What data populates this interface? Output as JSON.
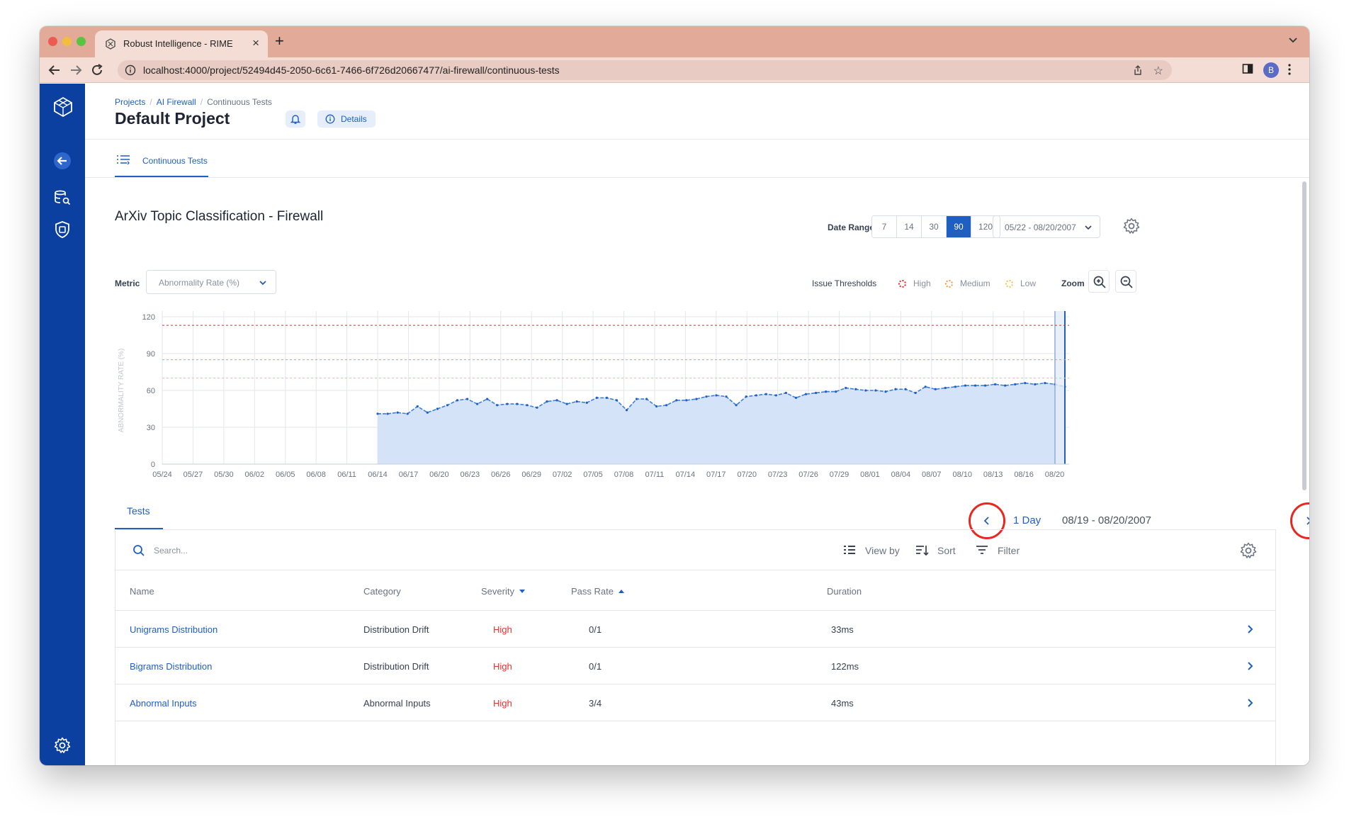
{
  "browser": {
    "tab_title": "Robust Intelligence - RIME",
    "url": "localhost:4000/project/52494d45-2050-6c61-7466-6f726d20667477/ai-firewall/continuous-tests",
    "profile_initial": "B"
  },
  "colors": {
    "sidebar": "#0b3fa0",
    "accent": "#1f5fc2",
    "severity_high": "#e0352b",
    "threshold_high": "#e8281e",
    "threshold_medium": "#f2994a",
    "threshold_low": "#f6c453",
    "area_fill": "#d4e3f8",
    "annotation": "#e8281e"
  },
  "sidebar": {
    "icons": [
      "logo-icon",
      "back-arrow-icon",
      "data-search-icon",
      "shield-chip-icon",
      "settings-gear-icon"
    ]
  },
  "breadcrumb": {
    "projects": "Projects",
    "firewall": "AI Firewall",
    "current": "Continuous Tests"
  },
  "header": {
    "title": "Default Project",
    "details_label": "Details"
  },
  "subnav": {
    "tab_label": "Continuous Tests"
  },
  "section": {
    "title": "ArXiv Topic Classification - Firewall"
  },
  "date_range": {
    "label": "Date Range",
    "options": [
      "7",
      "14",
      "30",
      "90",
      "120"
    ],
    "selected": "90",
    "value": "05/22 - 08/20/2007"
  },
  "metric": {
    "label": "Metric",
    "value": "Abnormality Rate (%)"
  },
  "thresholds": {
    "label": "Issue Thresholds",
    "high": "High",
    "medium": "Medium",
    "low": "Low"
  },
  "zoom": {
    "label": "Zoom"
  },
  "chart_data": {
    "type": "area",
    "ylabel": "ABNORMALITY RATE (%)",
    "ylim": [
      0,
      120
    ],
    "yticks": [
      "0",
      "30",
      "60",
      "90",
      "120"
    ],
    "x_tick_labels": [
      "05/24",
      "05/27",
      "05/30",
      "06/02",
      "06/05",
      "06/08",
      "06/11",
      "06/14",
      "06/17",
      "06/20",
      "06/23",
      "06/26",
      "06/29",
      "07/02",
      "07/05",
      "07/08",
      "07/11",
      "07/14",
      "07/17",
      "07/20",
      "07/23",
      "07/26",
      "07/29",
      "08/01",
      "08/04",
      "08/07",
      "08/10",
      "08/13",
      "08/16",
      "08/20"
    ],
    "x_dates": [
      "05/24",
      "05/27",
      "05/30",
      "06/02",
      "06/05",
      "06/08",
      "06/11",
      "06/14",
      "06/17",
      "06/20",
      "06/23",
      "06/26",
      "06/29",
      "07/02",
      "07/05",
      "07/08",
      "07/11",
      "07/14",
      "07/17",
      "07/20",
      "07/23",
      "07/26",
      "07/29",
      "08/01",
      "08/04",
      "08/07",
      "08/10",
      "08/13",
      "08/16",
      "08/19"
    ],
    "grid": true,
    "thresholds": {
      "high": 113,
      "medium": 85,
      "low": 70
    },
    "series": [
      {
        "x_start": "06/14",
        "x_end": "08/20",
        "values": [
          41,
          41,
          42,
          41,
          47,
          42,
          45,
          48,
          52,
          53,
          49,
          53,
          48,
          49,
          49,
          48,
          46,
          51,
          52,
          49,
          51,
          50,
          54,
          54,
          52,
          44,
          53,
          53,
          47,
          48,
          52,
          52,
          53,
          55,
          56,
          55,
          48,
          55,
          56,
          57,
          56,
          58,
          54,
          57,
          58,
          59,
          59,
          62,
          61,
          60,
          60,
          59,
          61,
          61,
          58,
          63,
          61,
          62,
          63,
          64,
          64,
          64,
          65,
          64,
          65,
          66,
          65,
          66,
          65,
          63
        ]
      }
    ],
    "selected_day": "08/20"
  },
  "tests": {
    "tab_label": "Tests",
    "day_label": "1 Day",
    "range_label": "08/19 - 08/20/2007",
    "search_placeholder": "Search...",
    "view_by_label": "View by",
    "sort_label": "Sort",
    "filter_label": "Filter",
    "columns": {
      "name": "Name",
      "category": "Category",
      "severity": "Severity",
      "pass_rate": "Pass Rate",
      "duration": "Duration"
    },
    "rows": [
      {
        "name": "Unigrams Distribution",
        "category": "Distribution Drift",
        "severity": "High",
        "pass_rate": "0/1",
        "duration": "33ms"
      },
      {
        "name": "Bigrams Distribution",
        "category": "Distribution Drift",
        "severity": "High",
        "pass_rate": "0/1",
        "duration": "122ms"
      },
      {
        "name": "Abnormal Inputs",
        "category": "Abnormal Inputs",
        "severity": "High",
        "pass_rate": "3/4",
        "duration": "43ms"
      }
    ]
  }
}
